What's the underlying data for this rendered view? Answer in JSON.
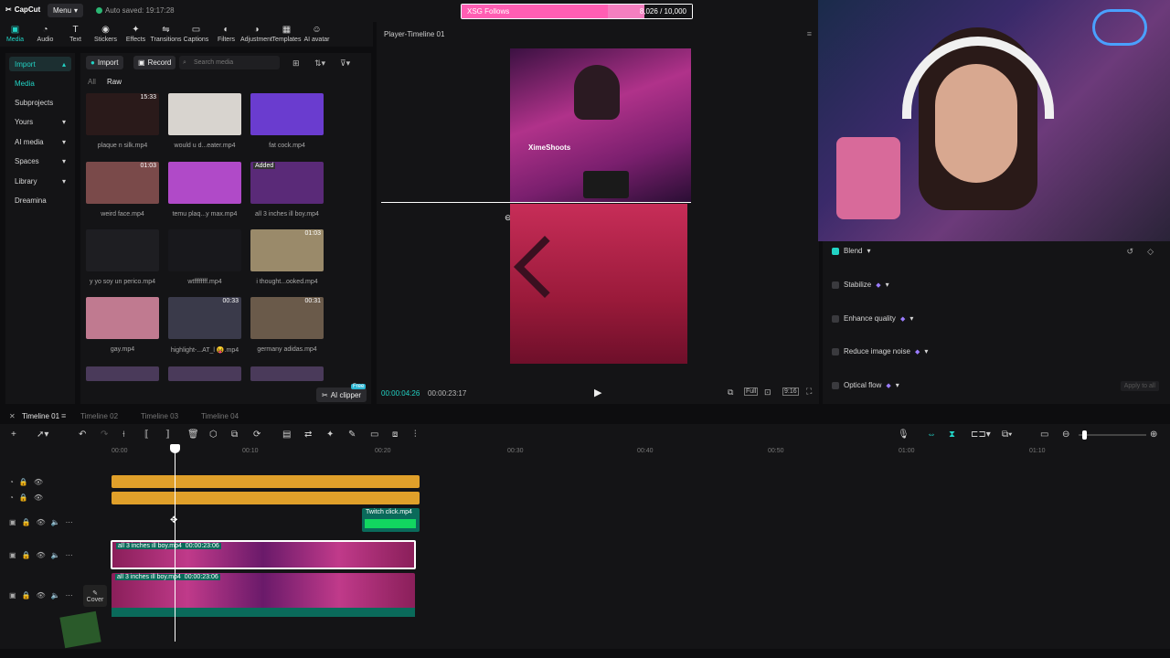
{
  "app": {
    "logo": "CapCut",
    "menu_label": "Menu",
    "autosave": "Auto saved: 19:17:28"
  },
  "goal": {
    "label": "XSG Follows",
    "current": "8,026",
    "target": "/ 10,000",
    "progress": 0.8026
  },
  "tools": [
    {
      "icon": "media-icon",
      "label": "Media"
    },
    {
      "icon": "audio-icon",
      "label": "Audio"
    },
    {
      "icon": "text-icon",
      "label": "Text"
    },
    {
      "icon": "stickers-icon",
      "label": "Stickers"
    },
    {
      "icon": "effects-icon",
      "label": "Effects"
    },
    {
      "icon": "transitions-icon",
      "label": "Transitions"
    },
    {
      "icon": "captions-icon",
      "label": "Captions"
    },
    {
      "icon": "filters-icon",
      "label": "Filters"
    },
    {
      "icon": "adjustment-icon",
      "label": "Adjustment"
    },
    {
      "icon": "templates-icon",
      "label": "Templates"
    },
    {
      "icon": "ai-avatar-icon",
      "label": "AI avatar"
    }
  ],
  "sidebar": {
    "items": [
      {
        "label": "Import"
      },
      {
        "label": "Media"
      },
      {
        "label": "Subprojects"
      },
      {
        "label": "Yours"
      },
      {
        "label": "AI media"
      },
      {
        "label": "Spaces"
      },
      {
        "label": "Library"
      },
      {
        "label": "Dreamina"
      }
    ]
  },
  "media_panel": {
    "import_label": "Import",
    "record_label": "Record",
    "search_placeholder": "Search media",
    "filter_all": "All",
    "filter_raw": "Raw",
    "ai_clipper": "AI clipper",
    "free_badge": "Free",
    "items": [
      {
        "name": "plaque n silk.mp4",
        "duration": "15:33",
        "color": "#2a1a1a"
      },
      {
        "name": "would u d...eater.mp4",
        "duration": "",
        "color": "#d8d4cf"
      },
      {
        "name": "fat cock.mp4",
        "duration": "",
        "color": "#6a3ccf"
      },
      {
        "name": "weird face.mp4",
        "duration": "01:03",
        "color": "#7a4a4a"
      },
      {
        "name": "temu plaq...y max.mp4",
        "duration": "",
        "color": "#b04ac8"
      },
      {
        "name": "all 3 inches ill boy.mp4",
        "duration": "",
        "added": "Added",
        "color": "#5a2a78"
      },
      {
        "name": "y yo soy un perico.mp4",
        "duration": "",
        "color": "#1e1e22"
      },
      {
        "name": "wtffffffff.mp4",
        "duration": "",
        "color": "#18181c"
      },
      {
        "name": "i thought...ooked.mp4",
        "duration": "01:03",
        "color": "#9a8a6a"
      },
      {
        "name": "gay.mp4",
        "duration": "",
        "color": "#c07a90"
      },
      {
        "name": "highlight-...AT_l 😝.mp4",
        "duration": "00:33",
        "color": "#3a3a4a"
      },
      {
        "name": "germany adidas.mp4",
        "duration": "00:31",
        "color": "#6a5a4a"
      }
    ]
  },
  "player": {
    "title": "Player-Timeline 01",
    "overlay_name": "XimeShoots",
    "current_time": "00:00:04:26",
    "total_time": "00:00:23:17",
    "full_label": "Full",
    "ratio_label": "9:16"
  },
  "properties": {
    "items": [
      {
        "label": "Blend",
        "checked": true
      },
      {
        "label": "Stabilize",
        "checked": false
      },
      {
        "label": "Enhance quality",
        "checked": false
      },
      {
        "label": "Reduce image noise",
        "checked": false
      },
      {
        "label": "Optical flow",
        "checked": false
      }
    ],
    "apply_all": "Apply to all"
  },
  "timeline": {
    "tabs": [
      "Timeline 01",
      "Timeline 02",
      "Timeline 03",
      "Timeline 04"
    ],
    "ticks": [
      "00:00",
      "00:10",
      "00:20",
      "00:30",
      "00:40",
      "00:50",
      "01:00",
      "01:10"
    ],
    "clip_twitch": "Twitch click.mp4",
    "clip_main_name": "all 3 inches ill boy.mp4",
    "clip_main_dur": "00:00:23:06",
    "cover_label": "Cover",
    "accent": "#22d3c5",
    "text_clip_color": "#e0a02a"
  }
}
